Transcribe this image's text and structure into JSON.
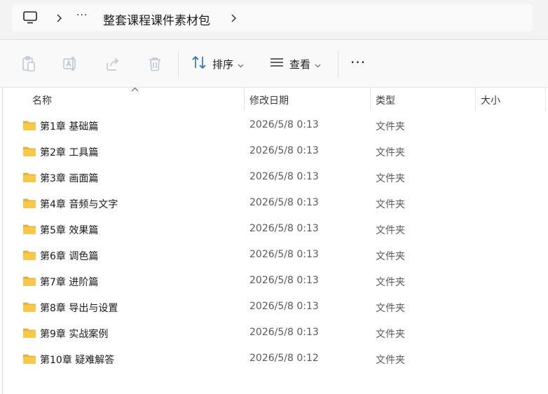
{
  "address_bar": {
    "overflow_label": "···",
    "crumb": "整套课程课件素材包"
  },
  "toolbar": {
    "sort_label": "排序",
    "view_label": "查看",
    "more_label": "···"
  },
  "columns": {
    "name": "名称",
    "date": "修改日期",
    "type": "类型",
    "size": "大小"
  },
  "files": [
    {
      "name": "第1章 基础篇",
      "date": "2026/5/8 0:13",
      "type": "文件夹",
      "size": ""
    },
    {
      "name": "第2章 工具篇",
      "date": "2026/5/8 0:13",
      "type": "文件夹",
      "size": ""
    },
    {
      "name": "第3章 画面篇",
      "date": "2026/5/8 0:13",
      "type": "文件夹",
      "size": ""
    },
    {
      "name": "第4章 音频与文字",
      "date": "2026/5/8 0:13",
      "type": "文件夹",
      "size": ""
    },
    {
      "name": "第5章 效果篇",
      "date": "2026/5/8 0:13",
      "type": "文件夹",
      "size": ""
    },
    {
      "name": "第6章 调色篇",
      "date": "2026/5/8 0:13",
      "type": "文件夹",
      "size": ""
    },
    {
      "name": "第7章 进阶篇",
      "date": "2026/5/8 0:13",
      "type": "文件夹",
      "size": ""
    },
    {
      "name": "第8章 导出与设置",
      "date": "2026/5/8 0:13",
      "type": "文件夹",
      "size": ""
    },
    {
      "name": "第9章 实战案例",
      "date": "2026/5/8 0:13",
      "type": "文件夹",
      "size": ""
    },
    {
      "name": "第10章 疑难解答",
      "date": "2026/5/8 0:12",
      "type": "文件夹",
      "size": ""
    }
  ],
  "colors": {
    "folder": "#f8c84a",
    "folder_tab": "#e9b23a",
    "disabled_icon": "#b9c6d6",
    "sort_icon": "#2b6cb0"
  }
}
